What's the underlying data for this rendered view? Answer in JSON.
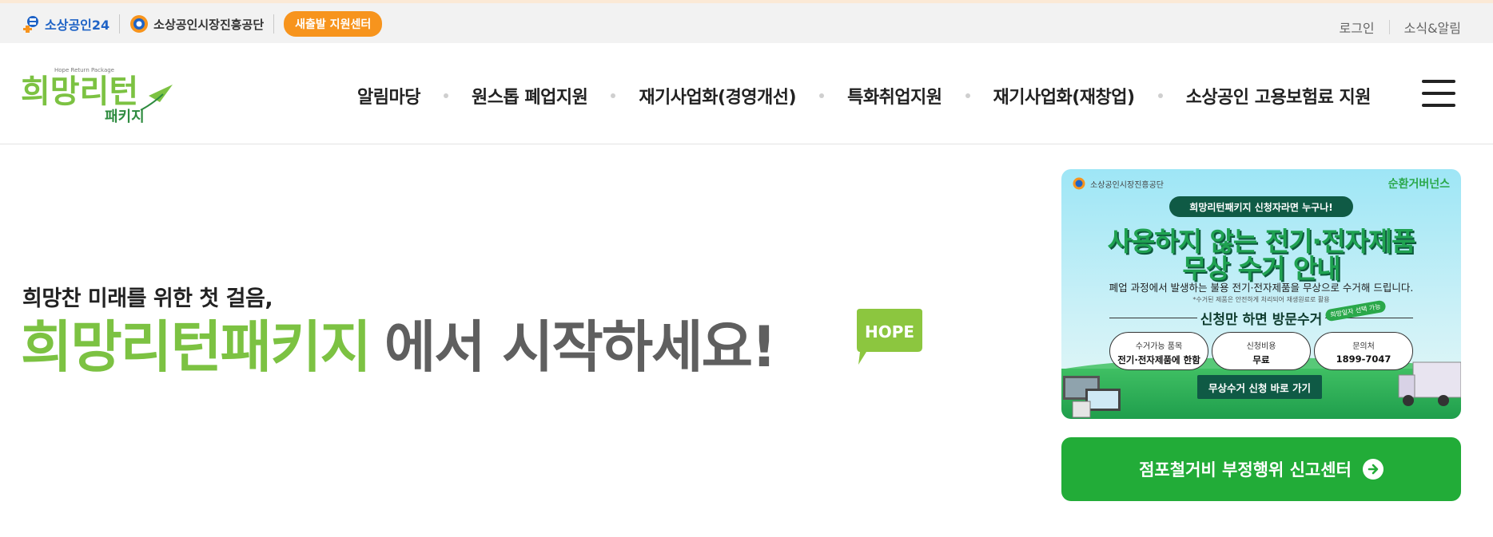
{
  "topbar": {
    "logo1_text": "소상공인24",
    "logo2_text": "소상공인시장진흥공단",
    "badge_label": "새출발 지원센터",
    "login_label": "로그인",
    "news_label": "소식&알림"
  },
  "header": {
    "logo_main": "희망리턴",
    "logo_sub": "패키지",
    "logo_en": "Hope Return Package",
    "nav": [
      {
        "label": "알림마당"
      },
      {
        "label": "원스톱 폐업지원"
      },
      {
        "label": "재기사업화(경영개선)"
      },
      {
        "label": "특화취업지원"
      },
      {
        "label": "재기사업화(재창업)"
      },
      {
        "label": "소상공인 고용보험료 지원"
      }
    ]
  },
  "hero": {
    "subtitle": "희망찬 미래를 위한 첫 걸음,",
    "title_green": "희망리턴패키지",
    "title_gray": "에서 시작하세요!",
    "badge_text": "HOPE"
  },
  "banner": {
    "org": "소상공인시장진흥공단",
    "brand": "순환거버넌스",
    "pill": "희망리턴패키지 신청자라면 누구나!",
    "headline1": "사용하지 않는 전기·전자제품",
    "headline2": "무상 수거 안내",
    "desc": "폐업 과정에서 발생하는 불용 전기·전자제품을 무상으로 수거해 드립니다.",
    "note": "*수거된 제품은 안전하게 처리되어 재생원료로 활용",
    "visit": "신청만 하면 방문수거",
    "tag": "희망일자 선택 가능",
    "info": [
      {
        "label": "수거가능 품목",
        "value": "전기·전자제품에 한함"
      },
      {
        "label": "신청비용",
        "value": "무료"
      },
      {
        "label": "문의처",
        "value": "1899-7047"
      }
    ],
    "button": "무상수거 신청 바로 가기"
  },
  "report_button": "점포철거비 부정행위 신고센터",
  "colors": {
    "brand_green": "#7cc242",
    "report_green": "#22ac38",
    "badge_orange": "#f7941d",
    "title_gray": "#5f5f5f"
  }
}
